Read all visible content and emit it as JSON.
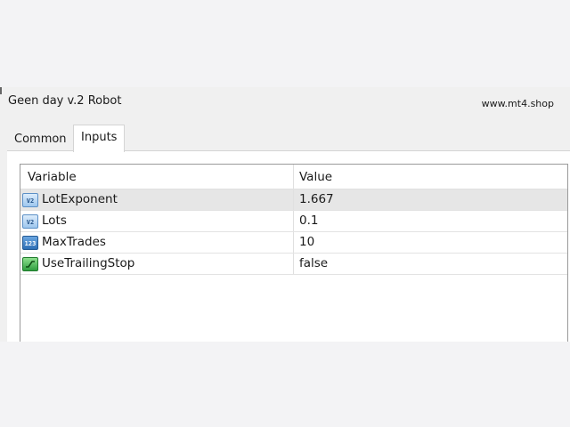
{
  "window": {
    "title": "Geen day v.2 Robot",
    "site": "www.mt4.shop"
  },
  "tabs": [
    {
      "label": "Common",
      "active": false
    },
    {
      "label": "Inputs",
      "active": true
    }
  ],
  "grid": {
    "columns": [
      "Variable",
      "Value"
    ],
    "rows": [
      {
        "icon": "double-type-icon",
        "variable": "LotExponent",
        "value": "1.667",
        "selected": true
      },
      {
        "icon": "double-type-icon",
        "variable": "Lots",
        "value": "0.1",
        "selected": false
      },
      {
        "icon": "integer-type-icon",
        "variable": "MaxTrades",
        "value": "10",
        "selected": false
      },
      {
        "icon": "boolean-type-icon",
        "variable": "UseTrailingStop",
        "value": "false",
        "selected": false
      }
    ]
  },
  "icons": {
    "double": "V2",
    "integer": "123"
  },
  "colors": {
    "background": "#f0f0f0",
    "selected_row": "#e6e6e6",
    "grid_border": "#9a9a9a"
  }
}
